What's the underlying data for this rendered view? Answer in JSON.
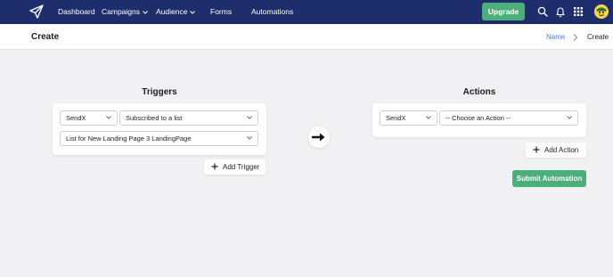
{
  "nav": {
    "dashboard": "Dashboard",
    "campaigns": "Campaigns",
    "audience": "Audience",
    "forms": "Forms",
    "automations": "Automations",
    "upgrade": "Upgrade"
  },
  "header": {
    "title": "Create",
    "breadcrumb_link": "Name",
    "breadcrumb_current": "Create"
  },
  "triggers": {
    "title": "Triggers",
    "provider": "SendX",
    "event": "Subscribed to a list",
    "list": "List for New Landing Page 3 LandingPage",
    "add_label": "Add Trigger"
  },
  "actions": {
    "title": "Actions",
    "provider": "SendX",
    "action": "-- Choose an Action --",
    "add_label": "Add Action",
    "submit_label": "Submit Automation"
  },
  "colors": {
    "navbar": "#1e2d6b",
    "accent_green": "#4cae78",
    "link_blue": "#4a7be0",
    "background": "#f1f1f4"
  }
}
